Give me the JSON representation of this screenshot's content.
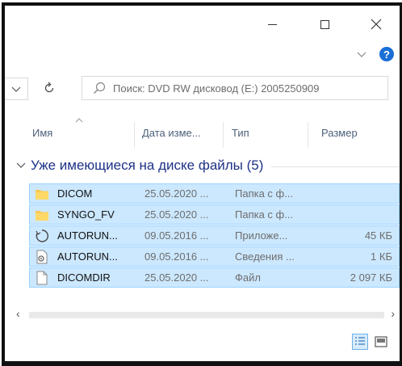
{
  "window": {
    "minimize_icon": "minimize-icon",
    "maximize_icon": "maximize-icon",
    "close_icon": "close-icon",
    "help_label": "?"
  },
  "search": {
    "placeholder": "Поиск: DVD RW дисковод (E:) 2005250909"
  },
  "columns": {
    "name": "Имя",
    "date": "Дата изме...",
    "type": "Тип",
    "size": "Размер"
  },
  "group": {
    "title": "Уже имеющиеся на диске файлы (5)"
  },
  "files": [
    {
      "name": "DICOM",
      "date": "25.05.2020 ...",
      "type": "Папка с ф...",
      "size": "",
      "icon": "folder-icon"
    },
    {
      "name": "SYNGO_FV",
      "date": "25.05.2020 ...",
      "type": "Папка с ф...",
      "size": "",
      "icon": "folder-icon"
    },
    {
      "name": "AUTORUN...",
      "date": "09.05.2016 ...",
      "type": "Приложе...",
      "size": "45 КБ",
      "icon": "application-icon"
    },
    {
      "name": "AUTORUN...",
      "date": "09.05.2016 ...",
      "type": "Сведения ...",
      "size": "1 КБ",
      "icon": "settings-file-icon"
    },
    {
      "name": "DICOMDIR",
      "date": "25.05.2020 ...",
      "type": "Файл",
      "size": "2 097 КБ",
      "icon": "file-icon"
    }
  ],
  "colors": {
    "selection_bg": "#cce8ff",
    "selection_border": "#99d1ff",
    "group_title": "#1e3287",
    "help_blue": "#1a6fd6"
  }
}
